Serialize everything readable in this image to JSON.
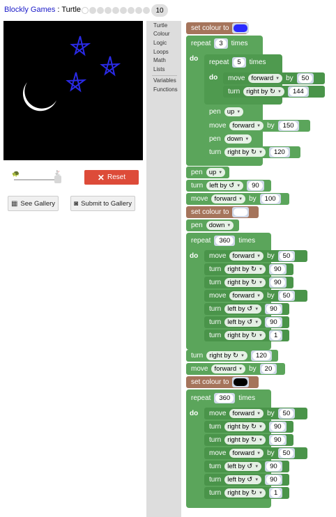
{
  "header": {
    "app_title": "Blockly Games",
    "separator": ":",
    "game_title": "Turtle",
    "current_level": "10"
  },
  "controls": {
    "reset_label": "Reset",
    "gallery_label": "See Gallery",
    "submit_label": "Submit to Gallery"
  },
  "toolbox": {
    "categories": [
      "Turtle",
      "Colour",
      "Logic",
      "Loops",
      "Math",
      "Lists",
      "Variables",
      "Functions"
    ]
  },
  "blocks": {
    "set_colour": "set colour to",
    "repeat": "repeat",
    "times": "times",
    "do": "do",
    "move": "move",
    "turn": "turn",
    "pen": "pen",
    "forward": "forward",
    "by": "by",
    "right_by": "right by ↻",
    "left_by": "left by ↺",
    "up": "up",
    "down": "down",
    "colour_blue": "#2a2aff",
    "colour_white": "#ffffff",
    "colour_black": "#000000",
    "v3": "3",
    "v5": "5",
    "v50": "50",
    "v144": "144",
    "v150": "150",
    "v120": "120",
    "v90": "90",
    "v100": "100",
    "v360": "360",
    "v1": "1",
    "v20": "20"
  },
  "canvas": {
    "background": "#000000",
    "star_colour": "#2a2ae6",
    "moon_colour": "#ffffff"
  }
}
